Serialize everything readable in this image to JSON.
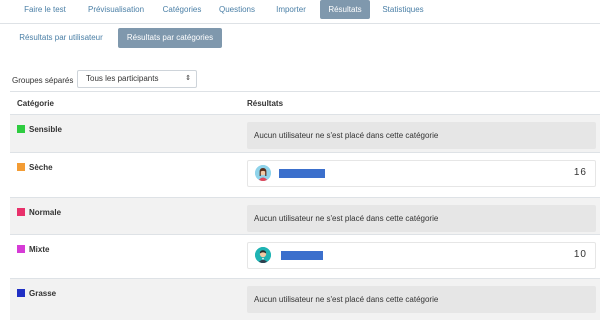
{
  "tabs": [
    {
      "label": "Faire le test",
      "active": false
    },
    {
      "label": "Prévisualisation",
      "active": false
    },
    {
      "label": "Catégories",
      "active": false
    },
    {
      "label": "Questions",
      "active": false
    },
    {
      "label": "Importer",
      "active": false
    },
    {
      "label": "Résultats",
      "active": true
    },
    {
      "label": "Statistiques",
      "active": false
    }
  ],
  "subtabs": [
    {
      "label": "Résultats par utilisateur",
      "active": false
    },
    {
      "label": "Résultats par catégories",
      "active": true
    }
  ],
  "groups": {
    "label": "Groupes séparés",
    "selected": "Tous les participants"
  },
  "table": {
    "headers": {
      "category": "Catégorie",
      "results": "Résultats"
    },
    "rows": [
      {
        "category": "Sensible",
        "color": "#2ecc40",
        "result_type": "empty",
        "message": "Aucun utilisateur ne s'est placé dans cette catégorie"
      },
      {
        "category": "Sèche",
        "color": "#f39c34",
        "result_type": "user",
        "score": "16"
      },
      {
        "category": "Normale",
        "color": "#e8316b",
        "result_type": "empty",
        "message": "Aucun utilisateur ne s'est placé dans cette catégorie"
      },
      {
        "category": "Mixte",
        "color": "#d63bd6",
        "result_type": "user",
        "score": "10"
      },
      {
        "category": "Grasse",
        "color": "#1f2fc4",
        "result_type": "empty",
        "message": "Aucun utilisateur ne s'est placé dans cette catégorie"
      }
    ]
  },
  "colors": {
    "accent": "#7f98ad",
    "link": "#4a7fa6",
    "redaction": "#3b6fcc",
    "row_shade": "#f2f2f2",
    "empty_box": "#e6e6e6"
  }
}
